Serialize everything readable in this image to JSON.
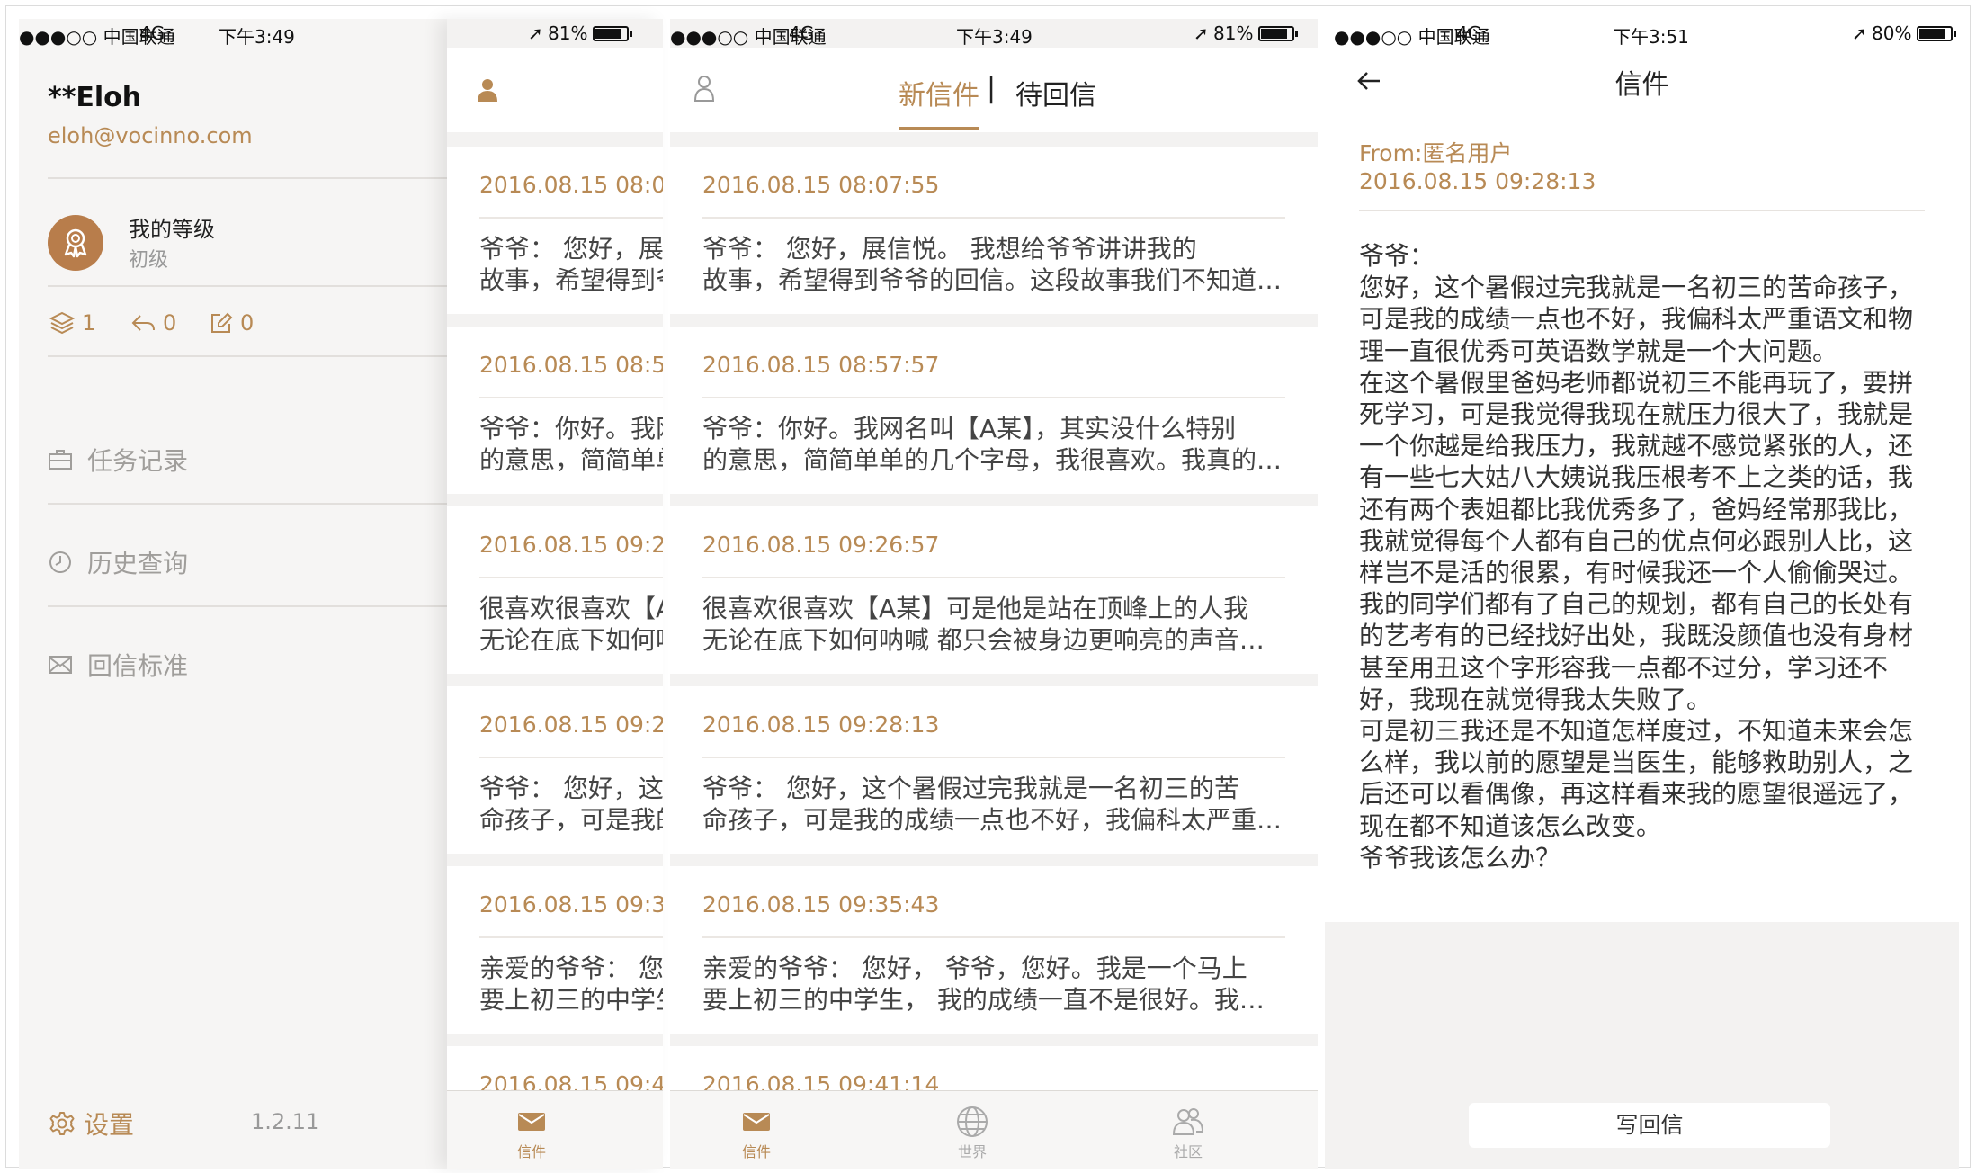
{
  "status_a": {
    "carrier": "●●●○○ 中国联通",
    "network": "4G",
    "time": "下午3:49",
    "battery": "81%"
  },
  "status_b": {
    "carrier": "●●●○○ 中国联通",
    "network": "4G",
    "time": "下午3:51",
    "battery": "80%"
  },
  "sidebar": {
    "user_name": "**Eloh",
    "user_email": "eloh@vocinno.com",
    "level_title": "我的等级",
    "level_value": "初级",
    "stats": {
      "letters": "1",
      "replies": "0",
      "tasks": "0"
    },
    "menu": [
      {
        "label": "任务记录",
        "icon": "briefcase-icon"
      },
      {
        "label": "历史查询",
        "icon": "clock-icon"
      },
      {
        "label": "回信标准",
        "icon": "mail-icon"
      }
    ],
    "settings_label": "设置",
    "version": "1.2.11"
  },
  "inbox": {
    "tabs": {
      "new": "新信件",
      "divider": "|",
      "pending": "待回信"
    },
    "letters": [
      {
        "date": "2016.08.15  08:07:55",
        "line1": "爷爷：    您好，展信悦。  我想给爷爷讲讲我的",
        "line2": "故事，希望得到爷爷的回信。这段故事我们不知道怎么开始"
      },
      {
        "date": "2016.08.15  08:57:57",
        "line1": "爷爷：你好。我网名叫【A某】，其实没什么特别",
        "line2": "的意思，简简单单的几个字母，我很喜欢。我真的很喜欢"
      },
      {
        "date": "2016.08.15  09:26:57",
        "line1": "很喜欢很喜欢【A某】可是他是站在顶峰上的人我",
        "line2": "无论在底下如何呐喊 都只会被身边更响亮的声音淹没"
      },
      {
        "date": "2016.08.15  09:28:13",
        "line1": "爷爷：  您好，这个暑假过完我就是一名初三的苦",
        "line2": "命孩子，可是我的成绩一点也不好，我偏科太严重语文"
      },
      {
        "date": "2016.08.15  09:35:43",
        "line1": "亲爱的爷爷：  您好，  爷爷，您好。我是一个马上",
        "line2": "要上初三的中学生，  我的成绩一直不是很好。我很担心"
      },
      {
        "date": "2016.08.15  09:41:14",
        "line1": "",
        "line2": ""
      }
    ],
    "tabbar": {
      "letters": "信件",
      "world": "世界",
      "community": "社区"
    }
  },
  "detail": {
    "title": "信件",
    "from": "From:匿名用户",
    "date": "2016.08.15 09:28:13",
    "body": [
      "爷爷：",
      "  您好，这个暑假过完我就是一名初三的苦命孩子，可是我的成绩一点也不好，我偏科太严重语文和物理一直很优秀可英语数学就是一个大问题。",
      "  在这个暑假里爸妈老师都说初三不能再玩了，要拼死学习，可是我觉得我现在就压力很大了，我就是一个你越是给我压力，我就越不感觉紧张的人，还有一些七大姑八大姨说我压根考不上之类的话，我还有两个表姐都比我优秀多了，爸妈经常那我比，我就觉得每个人都有自己的优点何必跟别人比，这样岂不是活的很累，有时候我还一个人偷偷哭过。",
      "  我的同学们都有了自己的规划，都有自己的长处有的艺考有的已经找好出处，我既没颜值也没有身材甚至用丑这个字形容我一点都不过分，学习还不好，我现在就觉得我太失败了。",
      "  可是初三我还是不知道怎样度过，不知道未来会怎么样，我以前的愿望是当医生，能够救助别人，之后还可以看偶像，再这样看来我的愿望很遥远了，现在都不知道该怎么改变。",
      "  爷爷我该怎么办？"
    ],
    "reply_label": "写回信"
  },
  "colors": {
    "accent": "#b88a55",
    "badge": "#b87d4b",
    "background": "#f3f2f1"
  }
}
